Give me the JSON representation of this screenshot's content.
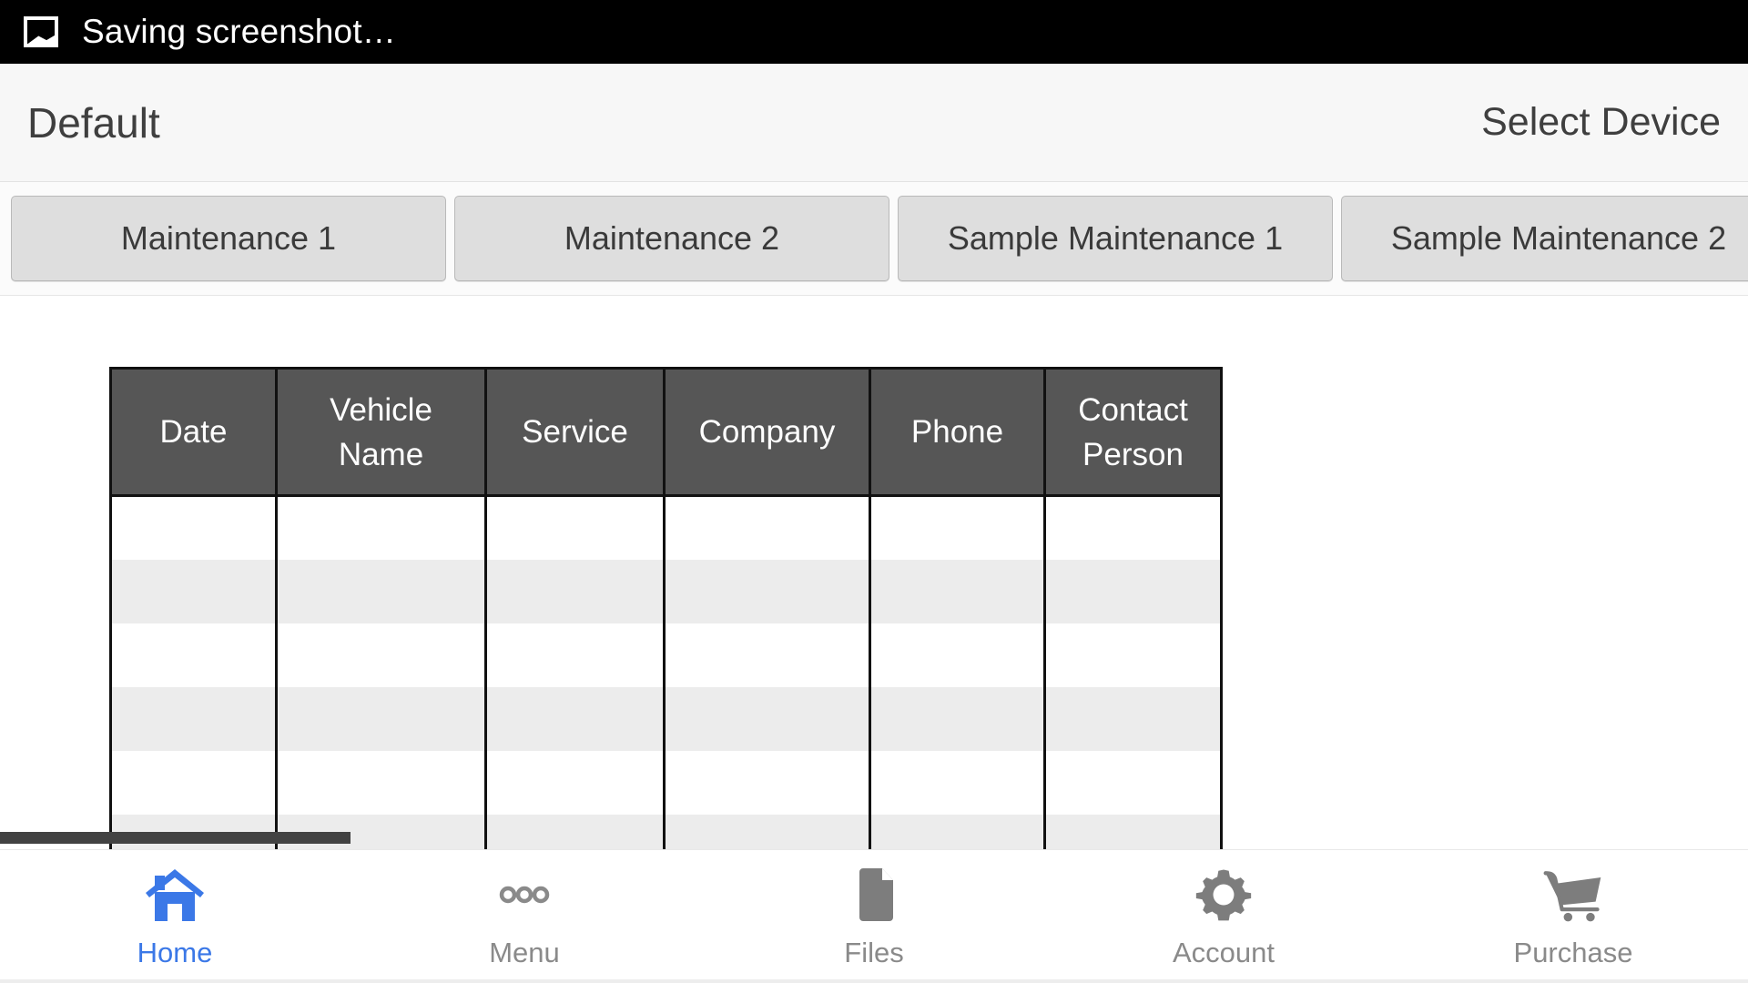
{
  "status_bar": {
    "icon": "screenshot-image-icon",
    "text": "Saving screenshot…",
    "background": "#000000",
    "foreground": "#ffffff"
  },
  "title_bar": {
    "title": "Default",
    "action": "Select Device"
  },
  "tabs": [
    {
      "label": "Maintenance 1"
    },
    {
      "label": "Maintenance 2"
    },
    {
      "label": "Sample Maintenance 1"
    },
    {
      "label": "Sample Maintenance 2"
    }
  ],
  "table": {
    "headers": [
      "Date",
      "Vehicle Name",
      "Service",
      "Company",
      "Phone",
      "Contact Person"
    ],
    "rows": [
      [
        "",
        "",
        "",
        "",
        "",
        ""
      ],
      [
        "",
        "",
        "",
        "",
        "",
        ""
      ],
      [
        "",
        "",
        "",
        "",
        "",
        ""
      ],
      [
        "",
        "",
        "",
        "",
        "",
        ""
      ],
      [
        "",
        "",
        "",
        "",
        "",
        ""
      ],
      [
        "",
        "",
        "",
        "",
        "",
        ""
      ]
    ],
    "header_background": "#565656",
    "header_text_color": "#ffffff",
    "border_color": "#111111",
    "stripe_color": "#ececec"
  },
  "scrollbar": {
    "orientation": "horizontal",
    "color": "#424242"
  },
  "bottom_nav": {
    "active_color": "#3b78e7",
    "inactive_color": "#8a8a8a",
    "items": [
      {
        "label": "Home",
        "icon": "home-icon",
        "active": true
      },
      {
        "label": "Menu",
        "icon": "dots-icon",
        "active": false
      },
      {
        "label": "Files",
        "icon": "file-icon",
        "active": false
      },
      {
        "label": "Account",
        "icon": "gear-icon",
        "active": false
      },
      {
        "label": "Purchase",
        "icon": "cart-icon",
        "active": false
      }
    ]
  }
}
